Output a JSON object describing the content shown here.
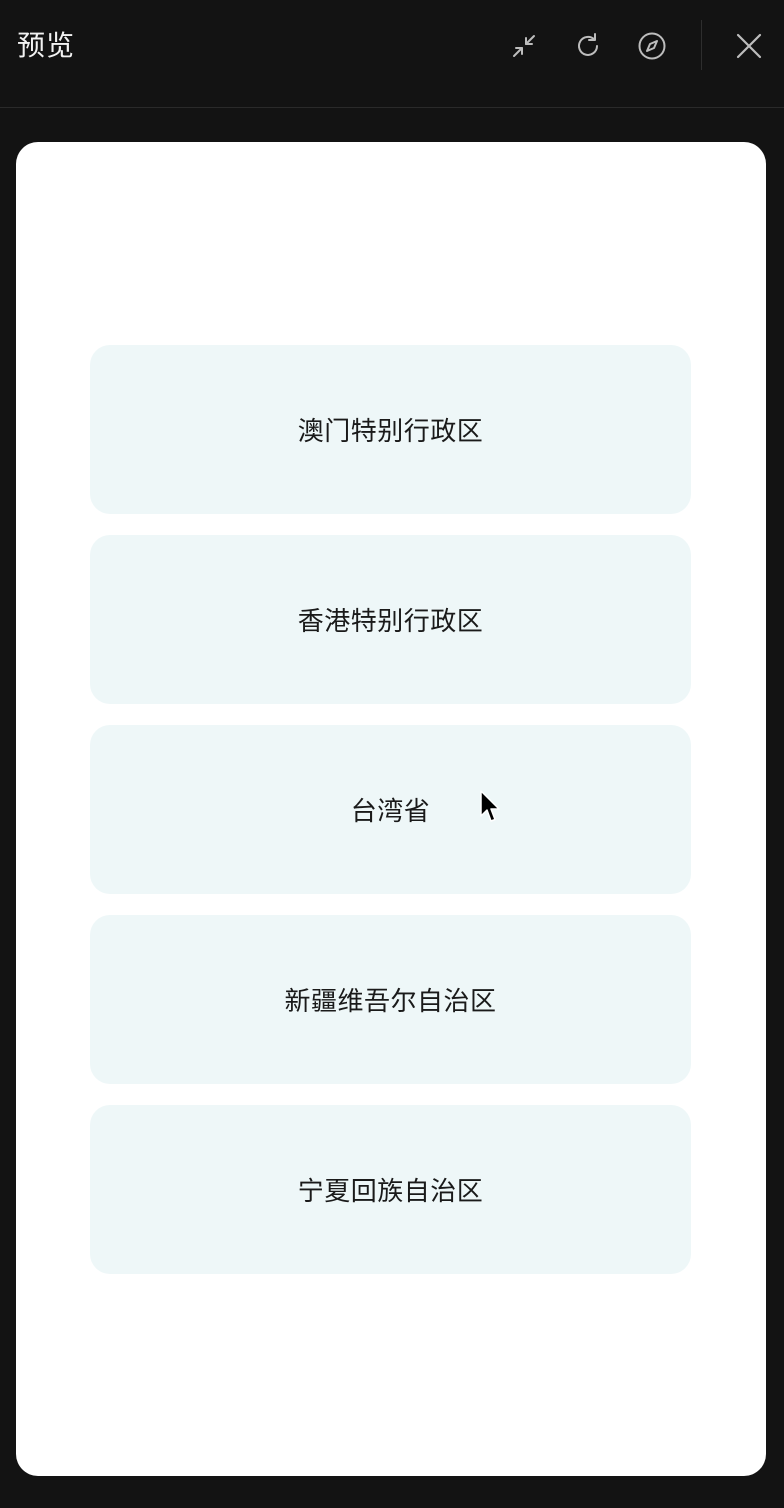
{
  "window": {
    "title": "预览",
    "toolbar_icons": [
      "collapse-icon",
      "refresh-icon",
      "compass-icon",
      "close-icon"
    ]
  },
  "list": {
    "items": [
      {
        "label": "澳门特别行政区"
      },
      {
        "label": "香港特别行政区"
      },
      {
        "label": "台湾省"
      },
      {
        "label": "新疆维吾尔自治区"
      },
      {
        "label": "宁夏回族自治区"
      }
    ]
  },
  "colors": {
    "window_bg": "#131313",
    "panel_bg": "#ffffff",
    "card_bg": "#eef7f8",
    "text": "#1a1a1a",
    "icon": "#bdbdbd"
  }
}
